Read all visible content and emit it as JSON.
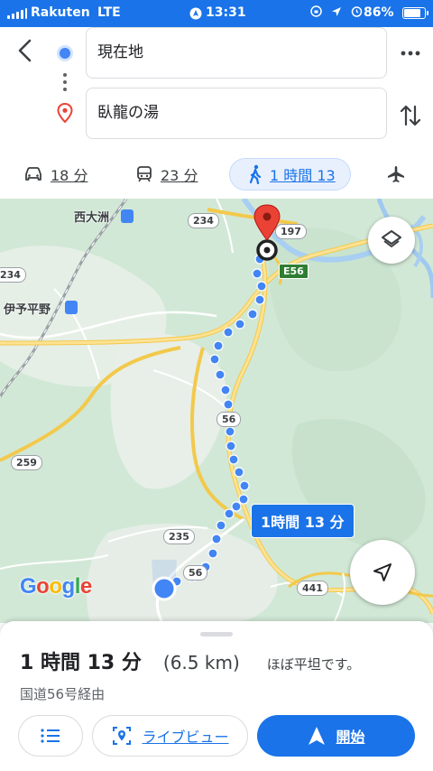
{
  "status_bar": {
    "carrier": "Rakuten",
    "network": "LTE",
    "time": "13:31",
    "battery_percent": "86%",
    "battery_level": 0.86
  },
  "route": {
    "origin": "現在地",
    "destination": "臥龍の湯"
  },
  "travel_modes": [
    {
      "icon": "car-icon",
      "label": "18 分"
    },
    {
      "icon": "train-icon",
      "label": "23 分"
    },
    {
      "icon": "walk-icon",
      "label": "1 時間 13"
    },
    {
      "icon": "airplane-icon",
      "label": ""
    }
  ],
  "map": {
    "places": {
      "nishi_ozu": "西大洲",
      "iyo_hirano": "伊予平野"
    },
    "road_shields": {
      "r234_top": "234",
      "r234_left": "234",
      "r197": "197",
      "e56": "E56",
      "r56_mid": "56",
      "r259": "259",
      "r235": "235",
      "r56_bottom": "56",
      "r441": "441"
    },
    "route_duration_chip": "1時間 13 分",
    "attribution": [
      "G",
      "o",
      "o",
      "g",
      "l",
      "e"
    ],
    "route_color": "#4285f4",
    "destination_pin_color": "#ea4335"
  },
  "summary": {
    "duration": "1 時間 13 分",
    "distance": "(6.5 km)",
    "terrain": "ほぼ平坦です。",
    "via": "国道56号経由"
  },
  "actions": {
    "live_view": "ライブビュー",
    "start": "開始"
  },
  "colors": {
    "accent": "#1a73e8",
    "status_bar": "#1a73e8"
  }
}
